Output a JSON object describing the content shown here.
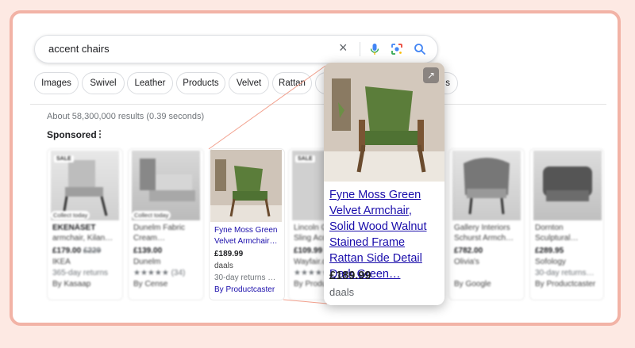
{
  "search": {
    "query": "accent chairs"
  },
  "chips": [
    "Images",
    "Swivel",
    "Leather",
    "Products",
    "Velvet",
    "Rattan",
    "s"
  ],
  "stats": "About 58,300,000 results (0.39 seconds)",
  "sponsored": {
    "label": "Sponsored",
    "menu": "⋮"
  },
  "cards": [
    {
      "badge": "SALE",
      "pick": "Collect today",
      "title": "EKENÄSET",
      "title2": "armchair, Kilan…",
      "price": "£179.00",
      "old": "£229",
      "store": "IKEA",
      "extra": "365-day returns",
      "by": "By Kasaap"
    },
    {
      "pick": "Collect today",
      "title": "Dunelm Fabric",
      "title2": "Cream…",
      "price": "£139.00",
      "store": "Dunelm",
      "extra": "★★★★★ (34)",
      "by": "By Cense"
    },
    {
      "badge": "SALE",
      "title": "Lincoln G…",
      "title2": "Sling Acc…",
      "price": "£109.99",
      "store": "Wayfair.c…",
      "extra": "★★★★★",
      "by": "By Produ…"
    },
    {
      "title": "Gallery Interiors",
      "title2": "Schurst Armch…",
      "price": "£782.00",
      "store": "Olivia's",
      "by": "By Google"
    },
    {
      "title": "Dornton",
      "title2": "Sculptural…",
      "price": "£289.95",
      "store": "Sofology",
      "extra": "30-day returns…",
      "by": "By Productcaster"
    }
  ],
  "highlight": {
    "title": "Fyne Moss Green",
    "title2": "Velvet Armchair…",
    "price": "£189.99",
    "store": "daals",
    "extra": "30-day returns …",
    "by": "By Productcaster"
  },
  "popup": {
    "title": "Fyne Moss Green Velvet Armchair, Solid Wood Walnut Stained Frame Rattan Side Detail Dark Green…",
    "price": "£189.99",
    "store": "daals",
    "open_icon": "↗"
  }
}
